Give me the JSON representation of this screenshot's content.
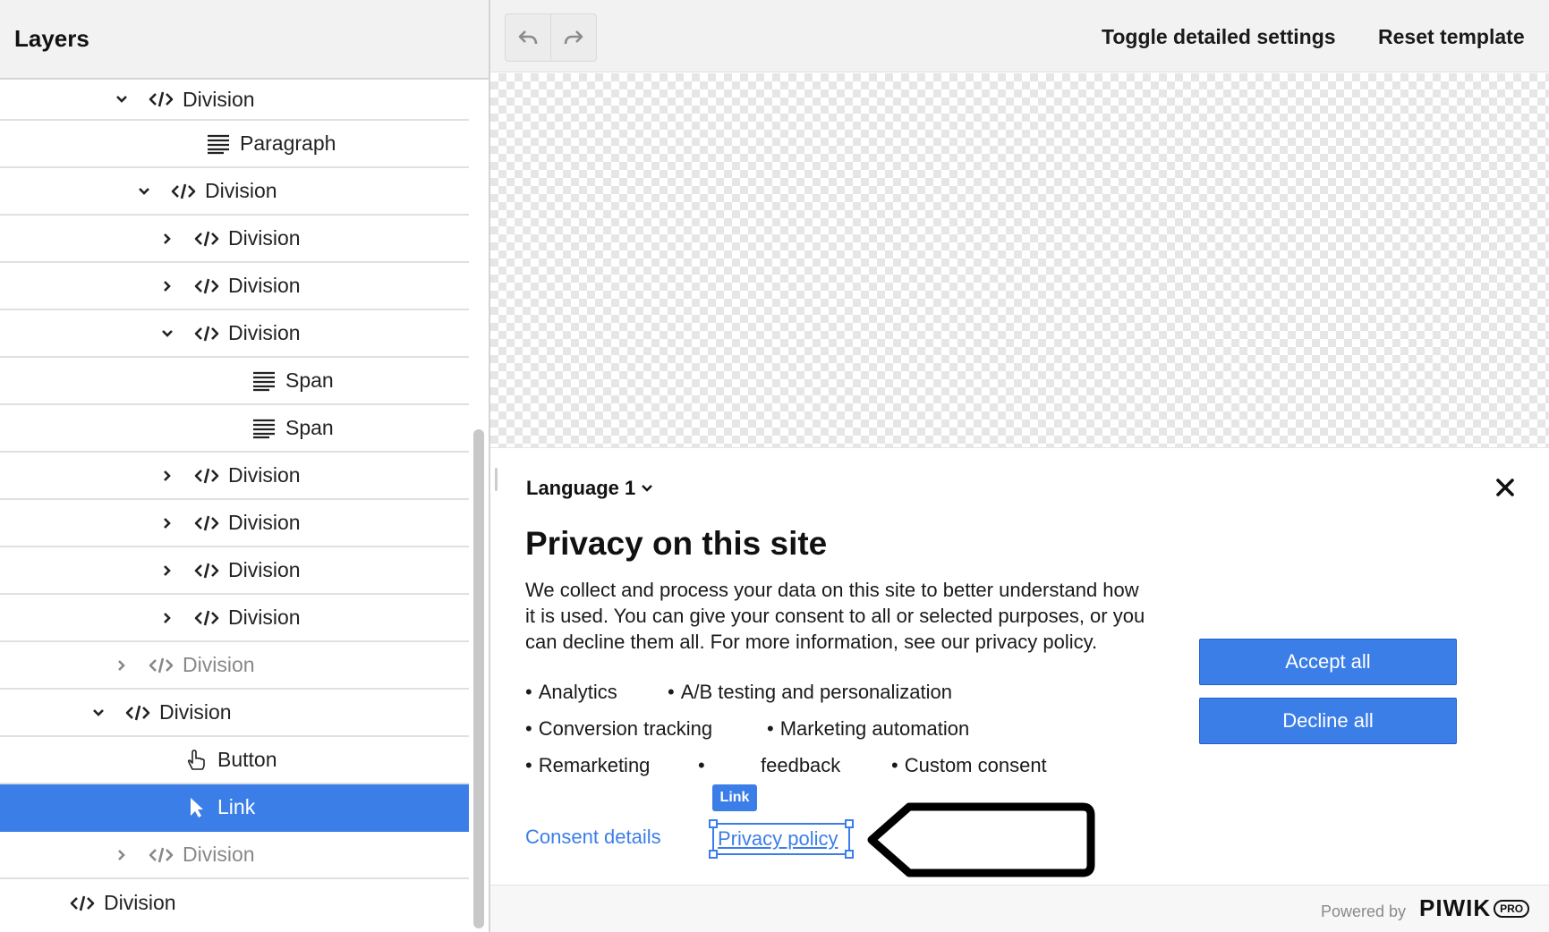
{
  "layers": {
    "title": "Layers",
    "rows": [
      {
        "label": "Division",
        "caret": "down",
        "icon": "code-icon"
      },
      {
        "label": "Paragraph",
        "caret": "none",
        "icon": "text-lines-icon"
      },
      {
        "label": "Division",
        "caret": "down",
        "icon": "code-icon"
      },
      {
        "label": "Division",
        "caret": "right",
        "icon": "code-icon"
      },
      {
        "label": "Division",
        "caret": "right",
        "icon": "code-icon"
      },
      {
        "label": "Division",
        "caret": "down",
        "icon": "code-icon"
      },
      {
        "label": "Span",
        "caret": "none",
        "icon": "text-lines-icon"
      },
      {
        "label": "Span",
        "caret": "none",
        "icon": "text-lines-icon"
      },
      {
        "label": "Division",
        "caret": "right",
        "icon": "code-icon"
      },
      {
        "label": "Division",
        "caret": "right",
        "icon": "code-icon"
      },
      {
        "label": "Division",
        "caret": "right",
        "icon": "code-icon"
      },
      {
        "label": "Division",
        "caret": "right",
        "icon": "code-icon"
      },
      {
        "label": "Division",
        "caret": "right",
        "icon": "code-icon",
        "hidden": true
      },
      {
        "label": "Division",
        "caret": "down",
        "icon": "code-icon"
      },
      {
        "label": "Button",
        "caret": "none",
        "icon": "hand-pointer-icon"
      },
      {
        "label": "Link",
        "caret": "none",
        "icon": "cursor-arrow-icon",
        "selected": true
      },
      {
        "label": "Division",
        "caret": "right",
        "icon": "code-icon",
        "hidden": true
      },
      {
        "label": "Division",
        "caret": "none",
        "icon": "code-icon"
      }
    ]
  },
  "toolbar": {
    "undo_icon": "undo-icon",
    "redo_icon": "redo-icon",
    "toggle_label": "Toggle detailed settings",
    "reset_label": "Reset template"
  },
  "banner": {
    "language": "Language 1",
    "title": "Privacy on this site",
    "description": "We collect and process your data on this site to better understand how it is used. You can give your consent to all or selected purposes, or you can decline them all. For more information, see our privacy policy.",
    "purposes": [
      "Analytics",
      "A/B testing and personalization",
      "Conversion tracking",
      "Marketing automation",
      "Remarketing",
      "feedback",
      "Custom consent"
    ],
    "link_badge": "Link",
    "consent_details": "Consent details",
    "privacy_policy": "Privacy policy",
    "accept_label": "Accept all",
    "decline_label": "Decline all",
    "bullet": "•"
  },
  "footer": {
    "powered_by": "Powered by",
    "brand": "PIWIK",
    "brand_suffix": "PRO"
  },
  "colors": {
    "accent": "#3b7ee8",
    "selected_row": "#3b7ee8",
    "toolbar_bg": "#f2f2f2"
  }
}
